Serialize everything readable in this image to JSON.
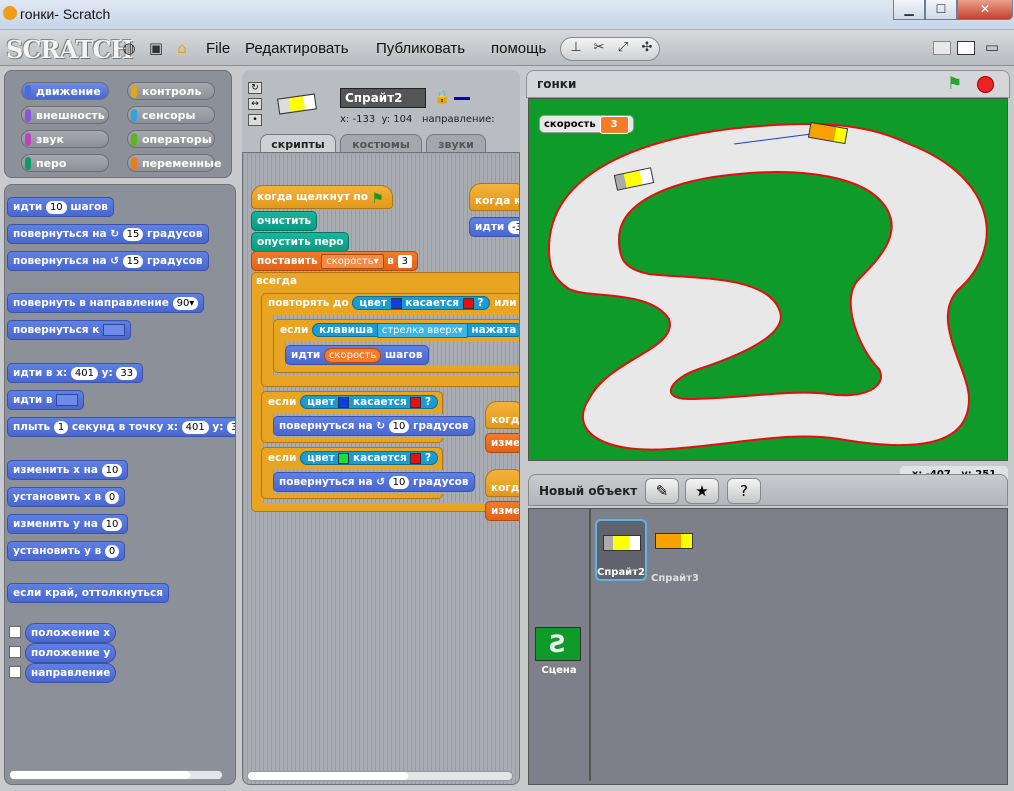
{
  "window": {
    "title": "гонки- Scratch",
    "minimize": "▁",
    "maximize": "☐",
    "close": "✕"
  },
  "menubar": {
    "logo": "SCRATCH",
    "items": [
      "File",
      "Редактировать",
      "Публиковать",
      "помощь"
    ],
    "icons": [
      "globe-icon",
      "save-icon",
      "share-icon"
    ]
  },
  "categories": [
    {
      "label": "движение",
      "color": "#4a6cd4"
    },
    {
      "label": "контроль",
      "color": "#e1a91a"
    },
    {
      "label": "внешность",
      "color": "#8a55d7"
    },
    {
      "label": "сенсоры",
      "color": "#2ca5e2"
    },
    {
      "label": "звук",
      "color": "#bb42c3"
    },
    {
      "label": "операторы",
      "color": "#5cb712"
    },
    {
      "label": "перо",
      "color": "#0e9a6c"
    },
    {
      "label": "переменные",
      "color": "#ee7d16"
    }
  ],
  "palette": {
    "move": {
      "a": "идти",
      "n": "10",
      "b": "шагов"
    },
    "turn_cw": {
      "a": "повернуться на",
      "n": "15",
      "b": "градусов"
    },
    "turn_ccw": {
      "a": "повернуться на",
      "n": "15",
      "b": "градусов"
    },
    "point_dir": {
      "a": "повернуть в направление",
      "n": "90▾"
    },
    "point_to": {
      "a": "повернуться к"
    },
    "goto_xy": {
      "a": "идти в x:",
      "x": "401",
      "b": "y:",
      "y": "33"
    },
    "goto": {
      "a": "идти в"
    },
    "glide": {
      "a": "плыть",
      "n": "1",
      "b": "секунд в точку x:",
      "x": "401",
      "c": "y:",
      "y": "3"
    },
    "change_x": {
      "a": "изменить x на",
      "n": "10"
    },
    "set_x": {
      "a": "установить x в",
      "n": "0"
    },
    "change_y": {
      "a": "изменить y на",
      "n": "10"
    },
    "set_y": {
      "a": "установить y в",
      "n": "0"
    },
    "bounce": "если край, оттолкнуться",
    "reporters": [
      "положение x",
      "положение y",
      "направление"
    ]
  },
  "sprite": {
    "name": "Спрайт2",
    "x_label": "x:",
    "x": "-133",
    "y_label": "y:",
    "y": "104",
    "dir_label": "направление:"
  },
  "tabs": [
    "скрипты",
    "костюмы",
    "звуки"
  ],
  "script": {
    "hat": "когда щелкнут по",
    "clear": "очистить",
    "pen_down": "опустить перо",
    "set_var": {
      "a": "поставить",
      "var": "скорость▾",
      "b": "в",
      "n": "3"
    },
    "forever": "всегда",
    "repeat_until": {
      "a": "повторять до",
      "b": "цвет",
      "c": "касается",
      "d": "?",
      "e": "или"
    },
    "if_key": {
      "a": "если",
      "b": "клавиша",
      "key": "стрелка вверх▾",
      "c": "нажата"
    },
    "move_var": {
      "a": "идти",
      "var": "скорость",
      "b": "шагов"
    },
    "if1": {
      "a": "если",
      "b": "цвет",
      "c": "касается",
      "d": "?"
    },
    "turn1": {
      "a": "повернуться на",
      "n": "10",
      "b": "градусов"
    },
    "if2": {
      "a": "если",
      "b": "цвет",
      "c": "касается",
      "d": "?"
    },
    "turn2": {
      "a": "повернуться на",
      "n": "10",
      "b": "градусов"
    },
    "side_hat": "когда к",
    "side_move": {
      "a": "идти",
      "n": "-3"
    },
    "side1": "когд",
    "side1b": "измен",
    "side2": "когд",
    "side2b": "измен"
  },
  "stage": {
    "title": "гонки",
    "monitor": {
      "label": "скорость",
      "value": "3"
    },
    "coords": {
      "x_label": "x:",
      "x": "-407",
      "y_label": "y:",
      "y": "251"
    }
  },
  "library": {
    "new_label": "Новый объект",
    "sprites": [
      "Спрайт2",
      "Спрайт3"
    ],
    "stage_label": "Сцена"
  }
}
